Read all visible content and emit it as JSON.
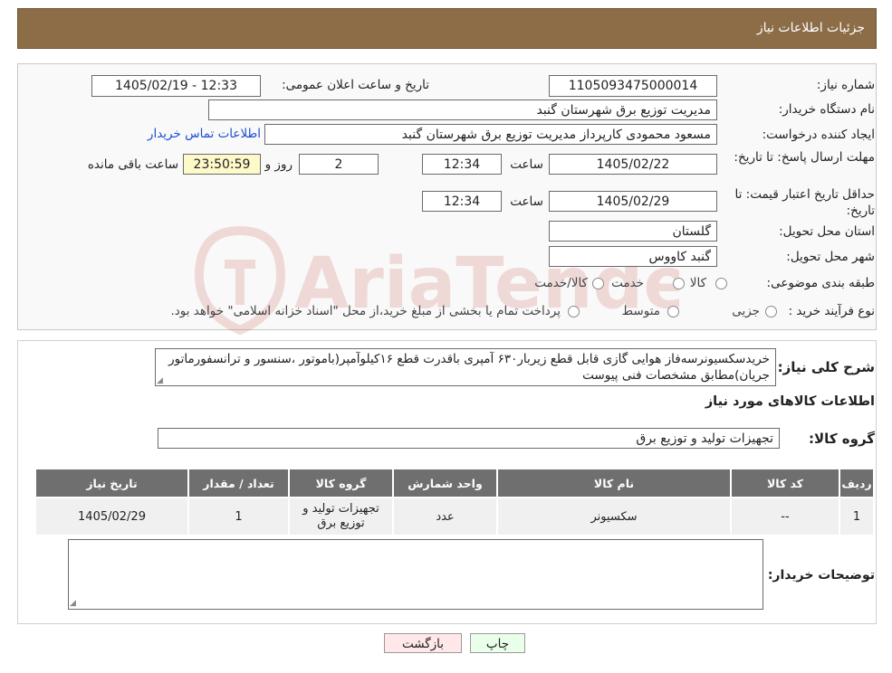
{
  "header": {
    "title": "جزئیات اطلاعات نیاز"
  },
  "form": {
    "need_number_label": "شماره نیاز:",
    "need_number": "1105093475000014",
    "announce_label": "تاریخ و ساعت اعلان عمومی:",
    "announce_value": "1405/02/19 - 12:33",
    "buyer_org_label": "نام دستگاه خریدار:",
    "buyer_org": "مدیریت توزیع برق شهرستان گنبد",
    "creator_label": "ایجاد کننده درخواست:",
    "creator": "مسعود محمودی کارپرداز مدیریت توزیع برق شهرستان گنبد",
    "contact_link": "اطلاعات تماس خریدار",
    "deadline_label": "مهلت ارسال پاسخ: تا تاریخ:",
    "deadline_date": "1405/02/22",
    "time_label": "ساعت",
    "deadline_time": "12:34",
    "days_value": "2",
    "days_label": "روز و",
    "remaining_time": "23:50:59",
    "remaining_label": "ساعت باقی مانده",
    "validity_label": "حداقل تاریخ اعتبار قیمت: تا تاریخ:",
    "validity_date": "1405/02/29",
    "validity_time": "12:34",
    "province_label": "استان محل تحویل:",
    "province": "گلستان",
    "city_label": "شهر محل تحویل:",
    "city": "گنبد کاووس",
    "category_label": "طبقه بندی موضوعی:",
    "category_options": [
      "کالا",
      "خدمت",
      "کالا/خدمت"
    ],
    "process_label": "نوع فرآیند خرید :",
    "process_options": [
      "جزیی",
      "متوسط"
    ],
    "process_note": "پرداخت تمام یا بخشی از مبلغ خرید،از محل \"اسناد خزانه اسلامی\" خواهد بود."
  },
  "description": {
    "label": "شرح کلی نیاز:",
    "text": "خریدسکسیونرسه‌فاز هوایی گازی قابل قطع زیربار۶۳۰ آمپری باقدرت قطع ۱۶کیلوآمپر(باموتور ،سنسور و ترانسفورماتور جریان)مطابق مشخصات فنی پیوست"
  },
  "goods": {
    "section_title": "اطلاعات کالاهای مورد نیاز",
    "group_label": "گروه کالا:",
    "group_value": "تجهیزات تولید و توزیع برق",
    "columns": [
      "ردیف",
      "کد کالا",
      "نام کالا",
      "واحد شمارش",
      "گروه کالا",
      "تعداد / مقدار",
      "تاریخ نیاز"
    ],
    "rows": [
      [
        "1",
        "--",
        "سکسیونر",
        "عدد",
        "تجهیزات تولید و توزیع برق",
        "1",
        "1405/02/29"
      ]
    ]
  },
  "buyer_notes": {
    "label": "توضیحات خریدار:",
    "value": ""
  },
  "buttons": {
    "print": "چاپ",
    "back": "بازگشت"
  },
  "watermark": {
    "text": "AriaTender.neT"
  }
}
